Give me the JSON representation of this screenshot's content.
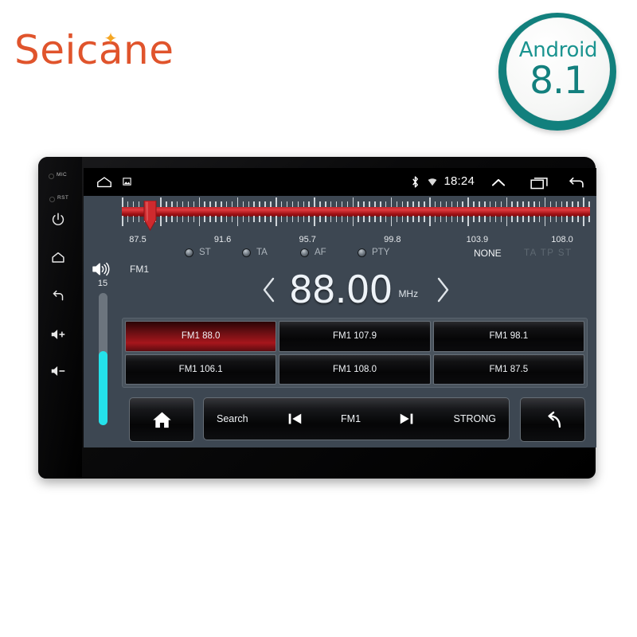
{
  "brand": {
    "name": "Seicane",
    "sparkle_icon": "sparkle-icon",
    "color": "#e0542c"
  },
  "android_badge": {
    "os_label": "Android",
    "version": "8.1",
    "ring_color": "#12807d",
    "text_color": "#13807e"
  },
  "device": {
    "bezel": {
      "mic_label": "MIC",
      "rst_label": "RST",
      "buttons": [
        {
          "name": "power-icon",
          "label": "Power"
        },
        {
          "name": "home-icon",
          "label": "Home"
        },
        {
          "name": "back-icon",
          "label": "Back"
        },
        {
          "name": "volume-up-icon",
          "label": "Vol +"
        },
        {
          "name": "volume-down-icon",
          "label": "Vol -"
        }
      ]
    }
  },
  "statusbar": {
    "time": "18:24",
    "left_icons": [
      "home-icon",
      "screenshot-icon"
    ],
    "right_icons": [
      "bluetooth-icon",
      "wifi-icon",
      "chevron-up-icon",
      "recents-icon",
      "back-icon"
    ]
  },
  "radio": {
    "volume": {
      "icon": "volume-icon",
      "value": "15",
      "fill_percent": 56,
      "fill_color": "#24e2ea"
    },
    "tuner": {
      "scale_labels": [
        "87.5",
        "91.6",
        "95.7",
        "99.8",
        "103.9",
        "108.0"
      ],
      "scale_min": 87.5,
      "scale_max": 108.0,
      "pointer_frequency": 88.0,
      "bar_color": "#c2262b"
    },
    "band": "FM1",
    "rds": [
      {
        "label": "ST",
        "on": false
      },
      {
        "label": "TA",
        "on": false
      },
      {
        "label": "AF",
        "on": false
      },
      {
        "label": "PTY",
        "on": false
      }
    ],
    "pty_value": "NONE",
    "dim_flags": "TA TP ST",
    "frequency": {
      "value": "88.00",
      "unit": "MHz",
      "prev_icon": "chevron-left-icon",
      "next_icon": "chevron-right-icon"
    },
    "presets": [
      {
        "label": "FM1 88.0",
        "active": true
      },
      {
        "label": "FM1 107.9",
        "active": false
      },
      {
        "label": "FM1 98.1",
        "active": false
      },
      {
        "label": "FM1 106.1",
        "active": false
      },
      {
        "label": "FM1 108.0",
        "active": false
      },
      {
        "label": "FM1 87.5",
        "active": false
      }
    ],
    "bottombar": {
      "home_icon": "home-icon",
      "back_icon": "back-arrow-icon",
      "search_label": "Search",
      "prev_icon": "skip-previous-icon",
      "band_label": "FM1",
      "next_icon": "skip-next-icon",
      "strength_label": "STRONG"
    }
  }
}
